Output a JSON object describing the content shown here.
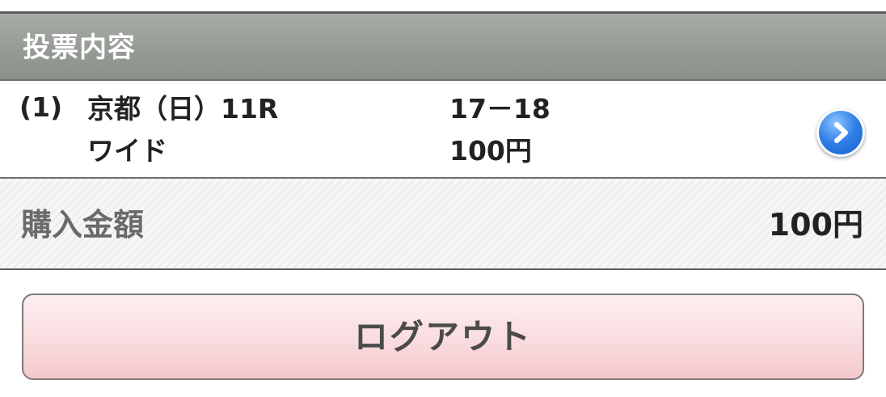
{
  "header": {
    "title": "投票内容"
  },
  "bet": {
    "index": "(1)",
    "race": "京都（日）11R",
    "bet_type": "ワイド",
    "combination": "17－18",
    "amount": "100円",
    "detail_icon": "chevron-right-icon"
  },
  "summary": {
    "label": "購入金額",
    "total": "100円"
  },
  "actions": {
    "logout_label": "ログアウト"
  },
  "colors": {
    "header_bg": "#969b95",
    "detail_button": "#2f7fe6",
    "logout_bg": "#f9dcdf"
  }
}
